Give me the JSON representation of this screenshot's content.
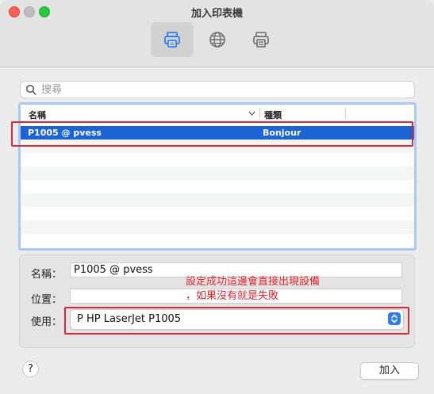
{
  "window": {
    "title": "加入印表機"
  },
  "toolbar": {
    "items": [
      {
        "icon": "printer-icon",
        "selected": true
      },
      {
        "icon": "globe-icon",
        "selected": false
      },
      {
        "icon": "windows-printer-icon",
        "selected": false
      }
    ]
  },
  "search": {
    "placeholder": "搜尋",
    "value": ""
  },
  "table": {
    "columns": [
      "名稱",
      "種類"
    ],
    "rows": [
      {
        "name": "P1005 @ pvess",
        "kind": "Bonjour",
        "selected": true
      }
    ]
  },
  "form": {
    "name_label": "名稱：",
    "name_value": "P1005 @ pvess",
    "location_label": "位置：",
    "location_value": "",
    "use_label": "使用：",
    "use_value": "P HP LaserJet P1005"
  },
  "annotation": {
    "line1": "設定成功這邊會直接出現設備",
    "line2": "，如果沒有就是失敗",
    "color": "#e0262e"
  },
  "footer": {
    "help_label": "?",
    "add_label": "加入"
  },
  "colors": {
    "selection": "#1b64d6",
    "accent": "#2f7cf6",
    "annotation_box": "#d9283c"
  }
}
